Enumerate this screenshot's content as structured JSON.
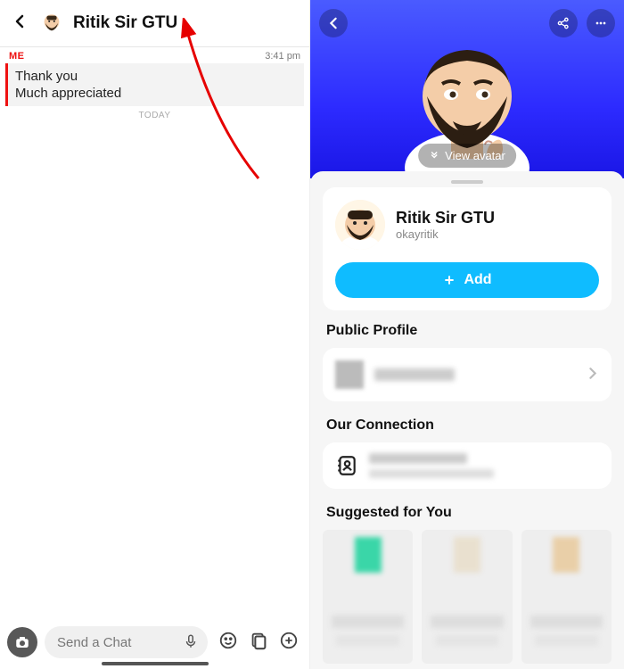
{
  "chat": {
    "header_name": "Ritik Sir GTU",
    "me_label": "ME",
    "timestamp": "3:41 pm",
    "messages": [
      "Thank you",
      "Much appreciated"
    ],
    "divider": "TODAY",
    "input_placeholder": "Send a Chat"
  },
  "profile": {
    "view_avatar_label": "View avatar",
    "name": "Ritik Sir GTU",
    "username": "okayritik",
    "add_label": "Add",
    "public_profile_title": "Public Profile",
    "connection_title": "Our Connection",
    "suggested_title": "Suggested for You"
  },
  "colors": {
    "accent": "#0fbcff",
    "alert": "#e11"
  }
}
